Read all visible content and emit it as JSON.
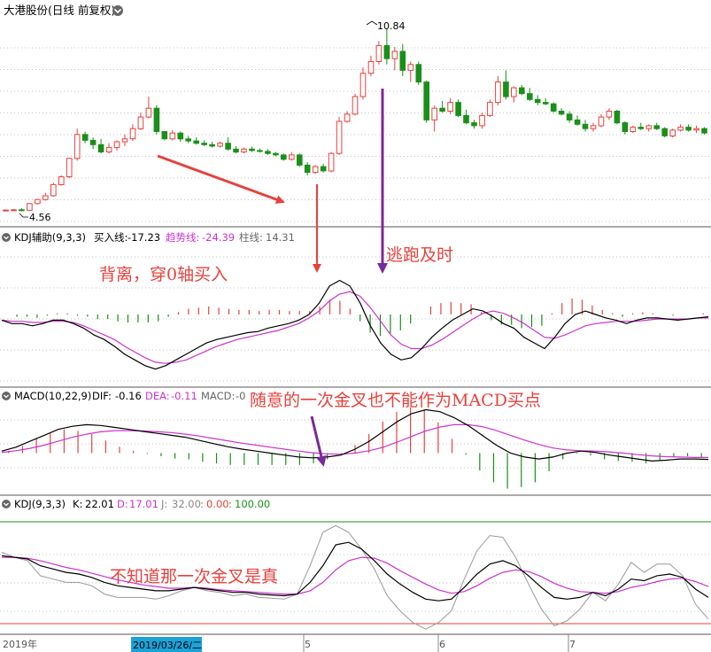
{
  "colors": {
    "up": "#e8413c",
    "down": "#1a8f1a",
    "k_line": "#000000",
    "d_line": "#cc33cc",
    "j_line": "#999999",
    "grid": "#b0b0b0",
    "panel_border": "#666666",
    "arrow_red": "#e8413c",
    "arrow_purple": "#7a2a9a",
    "annotation": "#e8413c",
    "date_highlight": "#1aa3d9"
  },
  "main": {
    "title": "大港股份(日线 前复权)",
    "price_high_label": "10.84",
    "price_low_label": "4.56",
    "collapse_icon": "circle-chevron-icon"
  },
  "kdj_aux": {
    "title": "KDJ辅助(9,3,3)",
    "buy_label": "买入线:",
    "buy_value": "-17.23",
    "trend_label": "趋势线:",
    "trend_value": "-24.39",
    "bar_label": "柱线:",
    "bar_value": "14.31"
  },
  "macd": {
    "title": "MACD(10,22,9)",
    "dif_label": "DIF:",
    "dif_value": "-0.16",
    "dea_label": "DEA:",
    "dea_value": "-0.11",
    "macd_label": "MACD:",
    "macd_value": "-0"
  },
  "kdj": {
    "title": "KDJ(9,3,3)",
    "k_label": "K:",
    "k_value": "22.01",
    "d_label": "D:",
    "d_value": "17.01",
    "j_label": "J:",
    "j_value": "32.00",
    "upper_band_value": "0.00",
    "lower_band_value": "100.00"
  },
  "annotations": {
    "divergence": "背离，穿0轴买入",
    "escape": "逃跑及时",
    "macd_cross": "随意的一次金叉也不能作为MACD买点",
    "kdj_cross": "不知道那一次金叉是真"
  },
  "x_axis": {
    "labels": [
      "2019年",
      "2019/03/26/二",
      "5",
      "6",
      "7"
    ]
  },
  "chart_data": {
    "type": "candlestick",
    "price_range": [
      4.56,
      10.84
    ],
    "candles": [
      [
        4.6,
        4.63,
        4.57,
        4.61
      ],
      [
        4.61,
        4.64,
        4.58,
        4.62
      ],
      [
        4.62,
        4.67,
        4.56,
        4.6
      ],
      [
        4.6,
        4.85,
        4.59,
        4.83
      ],
      [
        4.83,
        5.0,
        4.8,
        4.97
      ],
      [
        4.97,
        5.2,
        4.93,
        5.1
      ],
      [
        5.1,
        5.55,
        5.06,
        5.48
      ],
      [
        5.48,
        5.8,
        5.45,
        5.75
      ],
      [
        5.75,
        6.4,
        5.7,
        6.38
      ],
      [
        6.38,
        7.4,
        6.3,
        7.2
      ],
      [
        7.2,
        7.3,
        6.9,
        7.0
      ],
      [
        7.0,
        7.1,
        6.7,
        6.85
      ],
      [
        6.85,
        7.05,
        6.55,
        6.6
      ],
      [
        6.6,
        6.9,
        6.55,
        6.75
      ],
      [
        6.75,
        7.0,
        6.65,
        6.95
      ],
      [
        6.95,
        7.2,
        6.8,
        7.05
      ],
      [
        7.05,
        7.55,
        6.98,
        7.4
      ],
      [
        7.4,
        7.95,
        7.35,
        7.8
      ],
      [
        7.8,
        8.5,
        7.75,
        8.1
      ],
      [
        8.1,
        8.2,
        7.2,
        7.3
      ],
      [
        7.3,
        7.3,
        7.0,
        7.05
      ],
      [
        7.05,
        7.35,
        7.0,
        7.25
      ],
      [
        7.25,
        7.3,
        6.95,
        7.05
      ],
      [
        7.05,
        7.15,
        6.9,
        6.98
      ],
      [
        6.98,
        7.1,
        6.85,
        6.9
      ],
      [
        6.9,
        7.0,
        6.8,
        6.85
      ],
      [
        6.85,
        6.95,
        6.75,
        6.8
      ],
      [
        6.8,
        6.95,
        6.75,
        6.9
      ],
      [
        6.9,
        7.1,
        6.65,
        6.7
      ],
      [
        6.7,
        6.8,
        6.55,
        6.6
      ],
      [
        6.6,
        6.75,
        6.55,
        6.7
      ],
      [
        6.7,
        6.78,
        6.6,
        6.65
      ],
      [
        6.65,
        6.72,
        6.58,
        6.62
      ],
      [
        6.62,
        6.7,
        6.5,
        6.55
      ],
      [
        6.55,
        6.6,
        6.45,
        6.5
      ],
      [
        6.5,
        6.55,
        6.3,
        6.35
      ],
      [
        6.35,
        6.6,
        6.3,
        6.5
      ],
      [
        6.5,
        6.55,
        6.1,
        6.15
      ],
      [
        6.15,
        6.25,
        5.8,
        5.9
      ],
      [
        5.9,
        6.15,
        5.85,
        6.1
      ],
      [
        6.1,
        6.2,
        5.9,
        5.95
      ],
      [
        5.95,
        6.6,
        5.9,
        6.55
      ],
      [
        6.55,
        7.8,
        6.5,
        7.65
      ],
      [
        7.65,
        8.0,
        7.6,
        7.9
      ],
      [
        7.9,
        8.6,
        7.85,
        8.5
      ],
      [
        8.5,
        9.5,
        8.4,
        9.3
      ],
      [
        9.3,
        9.9,
        9.2,
        9.7
      ],
      [
        9.7,
        10.4,
        9.6,
        10.25
      ],
      [
        10.25,
        10.84,
        9.6,
        9.8
      ],
      [
        9.8,
        10.2,
        9.4,
        10.05
      ],
      [
        10.05,
        10.3,
        9.2,
        9.4
      ],
      [
        9.4,
        9.7,
        9.0,
        9.6
      ],
      [
        9.6,
        9.7,
        8.9,
        9.0
      ],
      [
        9.0,
        9.05,
        7.6,
        7.7
      ],
      [
        7.7,
        8.2,
        7.3,
        8.1
      ],
      [
        8.1,
        8.35,
        7.95,
        8.0
      ],
      [
        8.0,
        8.45,
        7.9,
        8.3
      ],
      [
        8.3,
        8.4,
        7.8,
        7.85
      ],
      [
        7.85,
        8.05,
        7.55,
        7.6
      ],
      [
        7.6,
        7.7,
        7.4,
        7.5
      ],
      [
        7.5,
        7.95,
        7.4,
        7.85
      ],
      [
        7.85,
        8.4,
        7.8,
        8.3
      ],
      [
        8.3,
        9.2,
        8.2,
        9.0
      ],
      [
        9.0,
        9.4,
        8.4,
        8.5
      ],
      [
        8.5,
        8.85,
        8.3,
        8.8
      ],
      [
        8.8,
        8.9,
        8.55,
        8.6
      ],
      [
        8.6,
        8.8,
        8.35,
        8.4
      ],
      [
        8.4,
        8.55,
        8.2,
        8.3
      ],
      [
        8.3,
        8.45,
        8.2,
        8.25
      ],
      [
        8.25,
        8.3,
        7.95,
        8.0
      ],
      [
        8.0,
        8.1,
        7.85,
        7.9
      ],
      [
        7.9,
        8.0,
        7.6,
        7.7
      ],
      [
        7.7,
        7.85,
        7.5,
        7.55
      ],
      [
        7.55,
        7.7,
        7.3,
        7.4
      ],
      [
        7.4,
        7.6,
        7.3,
        7.5
      ],
      [
        7.5,
        7.9,
        7.45,
        7.8
      ],
      [
        7.8,
        8.1,
        7.7,
        8.0
      ],
      [
        8.0,
        8.05,
        7.55,
        7.6
      ],
      [
        7.6,
        7.65,
        7.2,
        7.3
      ],
      [
        7.3,
        7.5,
        7.25,
        7.45
      ],
      [
        7.45,
        7.6,
        7.35,
        7.4
      ],
      [
        7.4,
        7.55,
        7.3,
        7.5
      ],
      [
        7.5,
        7.6,
        7.35,
        7.4
      ],
      [
        7.4,
        7.45,
        7.1,
        7.15
      ],
      [
        7.15,
        7.4,
        7.1,
        7.35
      ],
      [
        7.35,
        7.55,
        7.3,
        7.45
      ],
      [
        7.45,
        7.55,
        7.3,
        7.35
      ],
      [
        7.35,
        7.5,
        7.25,
        7.4
      ],
      [
        7.4,
        7.45,
        7.2,
        7.25
      ]
    ],
    "kdj_aux": {
      "ylim": [
        -60,
        60
      ],
      "buy_line": [
        -5,
        -8,
        -8,
        -10,
        -8,
        -5,
        -5,
        -8,
        -12,
        -18,
        -22,
        -28,
        -35,
        -40,
        -45,
        -48,
        -45,
        -40,
        -35,
        -30,
        -25,
        -22,
        -20,
        -18,
        -16,
        -15,
        -12,
        -10,
        -8,
        -5,
        0,
        10,
        25,
        30,
        25,
        10,
        -10,
        -25,
        -35,
        -40,
        -38,
        -30,
        -20,
        -12,
        -5,
        0,
        5,
        3,
        -2,
        -8,
        -12,
        -20,
        -25,
        -30,
        -20,
        -8,
        0,
        3,
        0,
        -3,
        -5,
        -8,
        -5,
        -3,
        -3,
        -4,
        -5,
        -4,
        -3,
        -2
      ],
      "trend_line": [
        -5,
        -6,
        -6,
        -7,
        -7,
        -6,
        -6,
        -7,
        -10,
        -14,
        -18,
        -22,
        -28,
        -33,
        -38,
        -42,
        -43,
        -42,
        -40,
        -36,
        -32,
        -28,
        -25,
        -22,
        -20,
        -18,
        -16,
        -14,
        -11,
        -8,
        -3,
        3,
        12,
        18,
        20,
        16,
        6,
        -6,
        -18,
        -26,
        -30,
        -30,
        -27,
        -22,
        -16,
        -10,
        -4,
        1,
        3,
        1,
        -3,
        -8,
        -14,
        -20,
        -21,
        -18,
        -14,
        -10,
        -8,
        -7,
        -6,
        -6,
        -6,
        -5,
        -4,
        -4,
        -4,
        -4,
        -3,
        -3
      ],
      "bars": [
        0,
        -2,
        -2,
        -3,
        -1,
        1,
        1,
        -1,
        -2,
        -4,
        -4,
        -6,
        -7,
        -7,
        -7,
        -6,
        -2,
        2,
        5,
        6,
        7,
        6,
        5,
        4,
        4,
        3,
        4,
        4,
        3,
        3,
        3,
        7,
        13,
        12,
        5,
        -6,
        -16,
        -19,
        -17,
        -14,
        -8,
        0,
        7,
        10,
        11,
        10,
        9,
        2,
        -5,
        -9,
        -9,
        -12,
        -11,
        -10,
        1,
        10,
        14,
        13,
        8,
        4,
        1,
        -2,
        1,
        2,
        1,
        0,
        -1,
        0,
        0,
        1
      ]
    },
    "macd": {
      "ylim": [
        -1.0,
        1.2
      ],
      "dif": [
        0.05,
        0.15,
        0.3,
        0.45,
        0.6,
        0.68,
        0.72,
        0.7,
        0.65,
        0.6,
        0.55,
        0.5,
        0.45,
        0.4,
        0.32,
        0.24,
        0.16,
        0.1,
        0.05,
        0.0,
        -0.05,
        -0.1,
        -0.12,
        -0.1,
        -0.05,
        0.1,
        0.3,
        0.55,
        0.8,
        1.0,
        1.1,
        1.05,
        0.9,
        0.7,
        0.45,
        0.2,
        0.0,
        -0.1,
        -0.15,
        -0.1,
        0.0,
        0.05,
        0.02,
        -0.05,
        -0.1,
        -0.15,
        -0.2,
        -0.18,
        -0.15,
        -0.15,
        -0.16
      ],
      "dea": [
        0.02,
        0.06,
        0.12,
        0.2,
        0.3,
        0.4,
        0.48,
        0.54,
        0.57,
        0.57,
        0.56,
        0.54,
        0.52,
        0.48,
        0.43,
        0.37,
        0.31,
        0.25,
        0.2,
        0.15,
        0.1,
        0.05,
        0.01,
        -0.02,
        -0.03,
        0.0,
        0.06,
        0.15,
        0.28,
        0.42,
        0.56,
        0.66,
        0.72,
        0.72,
        0.67,
        0.57,
        0.45,
        0.33,
        0.22,
        0.13,
        0.08,
        0.06,
        0.05,
        0.03,
        0.0,
        -0.04,
        -0.07,
        -0.09,
        -0.1,
        -0.11,
        -0.11
      ],
      "bars": [
        0.06,
        0.18,
        0.36,
        0.5,
        0.6,
        0.56,
        0.48,
        0.32,
        0.16,
        0.06,
        -0.02,
        -0.08,
        -0.14,
        -0.16,
        -0.22,
        -0.26,
        -0.3,
        -0.3,
        -0.3,
        -0.3,
        -0.3,
        -0.3,
        -0.26,
        -0.16,
        -0.04,
        0.2,
        0.48,
        0.8,
        1.04,
        1.16,
        1.08,
        0.78,
        0.36,
        -0.04,
        -0.44,
        -0.74,
        -0.9,
        -0.86,
        -0.74,
        -0.46,
        -0.16,
        -0.02,
        -0.06,
        -0.16,
        -0.2,
        -0.22,
        -0.26,
        -0.18,
        -0.1,
        -0.08,
        -0.1
      ]
    },
    "kdj": {
      "ylim": [
        0,
        100
      ],
      "k": [
        72,
        70,
        68,
        60,
        56,
        52,
        50,
        46,
        40,
        36,
        34,
        32,
        30,
        30,
        32,
        34,
        32,
        30,
        28,
        28,
        26,
        25,
        24,
        26,
        40,
        60,
        85,
        88,
        80,
        66,
        50,
        38,
        28,
        20,
        18,
        20,
        34,
        50,
        62,
        66,
        60,
        48,
        34,
        22,
        20,
        22,
        28,
        24,
        32,
        44,
        42,
        48,
        50,
        46,
        32,
        22
      ],
      "d": [
        70,
        70,
        69,
        66,
        62,
        58,
        55,
        51,
        47,
        43,
        40,
        37,
        35,
        33,
        33,
        34,
        33,
        31,
        30,
        29,
        28,
        27,
        26,
        26,
        30,
        40,
        55,
        66,
        70,
        69,
        63,
        54,
        46,
        38,
        31,
        27,
        29,
        36,
        45,
        52,
        55,
        53,
        47,
        39,
        33,
        29,
        28,
        27,
        29,
        34,
        37,
        41,
        44,
        45,
        41,
        35
      ],
      "j": [
        76,
        70,
        66,
        48,
        44,
        40,
        40,
        36,
        26,
        22,
        22,
        22,
        20,
        24,
        30,
        34,
        30,
        28,
        24,
        26,
        22,
        21,
        20,
        26,
        60,
        100,
        108,
        100,
        80,
        56,
        24,
        6,
        -8,
        -16,
        -8,
        6,
        44,
        78,
        96,
        94,
        70,
        38,
        8,
        -12,
        -6,
        8,
        28,
        18,
        38,
        64,
        52,
        62,
        62,
        48,
        14,
        -4
      ]
    }
  }
}
